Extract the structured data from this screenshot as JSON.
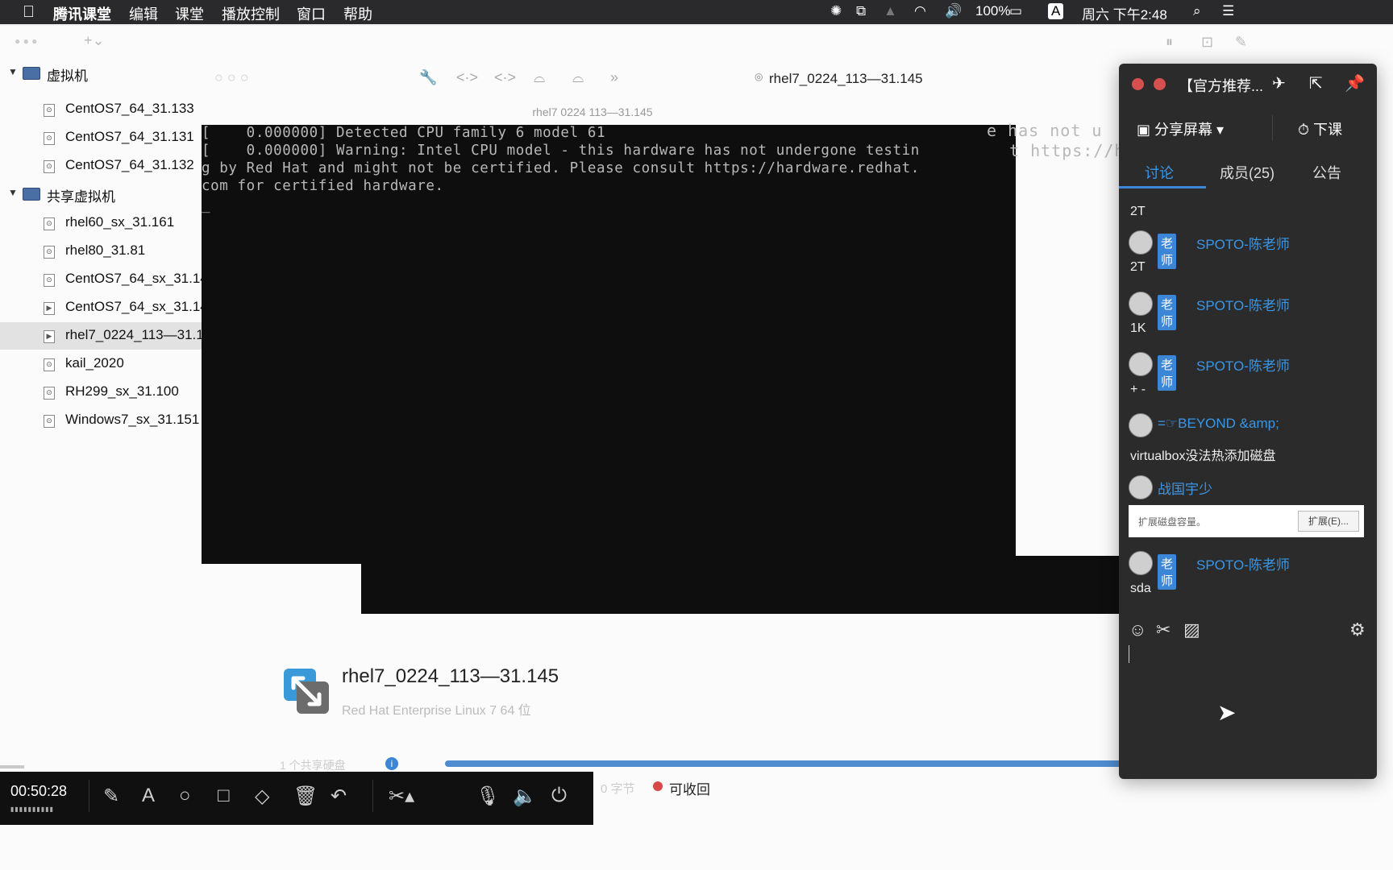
{
  "menubar": {
    "app": "腾讯课堂",
    "items": [
      "编辑",
      "课堂",
      "播放控制",
      "窗口",
      "帮助"
    ],
    "battery": "100%",
    "input_method": "A",
    "clock": "周六 下午2:48"
  },
  "sidebar": {
    "group1": "虚拟机",
    "group1_items": [
      "CentOS7_64_31.133",
      "CentOS7_64_31.131",
      "CentOS7_64_31.132"
    ],
    "group2": "共享虚拟机",
    "group2_items": [
      "rhel60_sx_31.161",
      "rhel80_31.81",
      "CentOS7_64_sx_31.14",
      "CentOS7_64_sx_31.14",
      "rhel7_0224_113—31.1",
      "kail_2020",
      "RH299_sx_31.100",
      "Windows7_sx_31.151"
    ]
  },
  "toolbar": {
    "vm_title": "rhel7_0224_113—31.145",
    "console_title": "rhel7 0224 113—31.145"
  },
  "console": {
    "lines": [
      "[    0.000000] Detected CPU family 6 model 61",
      "[    0.000000] Warning: Intel CPU model - this hardware has not undergone testin",
      "g by Red Hat and might not be certified. Please consult https://hardware.redhat.",
      "com for certified hardware."
    ],
    "right_lines": [
      "e has not u",
      "t https://ha"
    ],
    "cursor": "_"
  },
  "vm_info": {
    "name": "rhel7_0224_113—31.145",
    "os": "Red Hat Enterprise Linux 7 64 位",
    "disk_note": "1 个共享硬盘",
    "reclaim_prefix": "0 字节",
    "reclaim": "可收回"
  },
  "control_bar": {
    "timer": "00:50:28",
    "timer_dots": "▮▮▮▮▮▮▮▮▮▮"
  },
  "chat": {
    "title": "【官方推荐...",
    "share_screen": "分享屏幕",
    "end_class": "下课",
    "tabs": [
      "讨论",
      "成员(25)",
      "公告"
    ],
    "teacher_badge": "老师",
    "teacher_name": "SPOTO-陈老师",
    "messages": {
      "m0": "2T",
      "m1": "2T",
      "m2": "1K",
      "m3": "+ -",
      "beyond_name": "=☞BEYOND &amp;",
      "m4": "virtualbox没法热添加磁盘",
      "zhanguo_name": "战国宇少",
      "img_text": "扩展磁盘容量。",
      "img_btn": "扩展(E)...",
      "m5": "sda"
    }
  },
  "colors": {
    "accent": "#3b86d6",
    "console_bg": "#0e0e0e",
    "chat_bg": "#2b2b2b"
  }
}
